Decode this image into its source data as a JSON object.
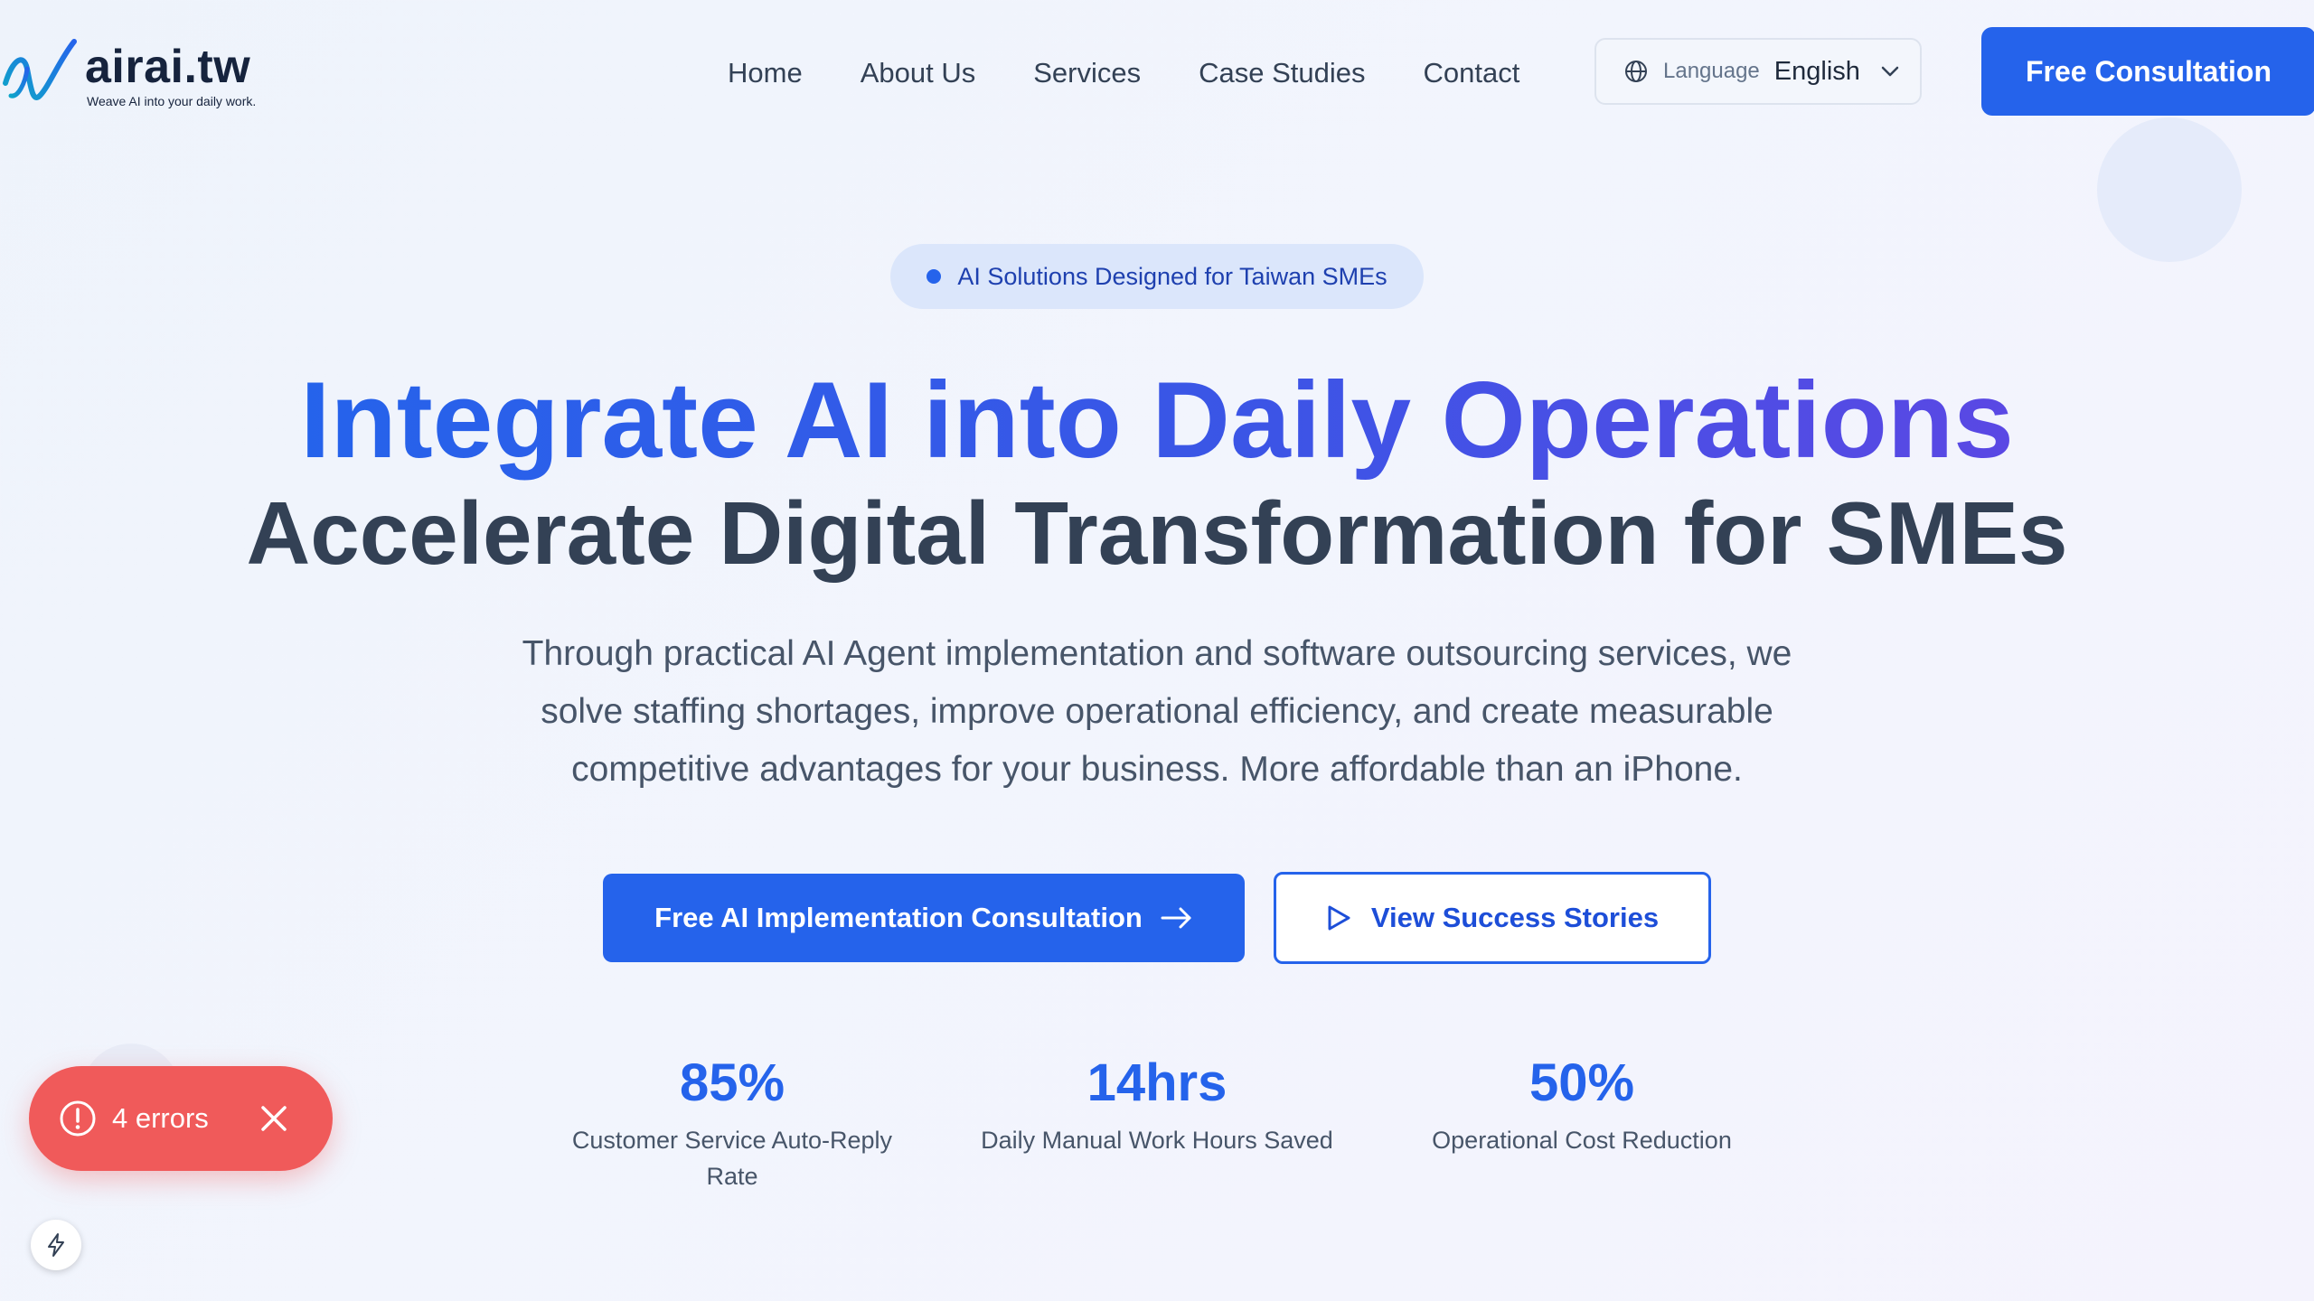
{
  "brand": {
    "name": "airai.tw",
    "tagline": "Weave AI into your daily work.",
    "accent_color": "#2563eb",
    "logo_icon": "stylized-n-logo-icon"
  },
  "nav": {
    "items": [
      {
        "label": "Home"
      },
      {
        "label": "About Us"
      },
      {
        "label": "Services"
      },
      {
        "label": "Case Studies"
      },
      {
        "label": "Contact"
      }
    ]
  },
  "language": {
    "icon": "globe-icon",
    "label": "Language",
    "selected": "English"
  },
  "header_cta": {
    "label": "Free Consultation"
  },
  "hero": {
    "badge": "AI Solutions Designed for Taiwan SMEs",
    "headline_1": "Integrate AI into Daily Operations",
    "headline_2": "Accelerate Digital Transformation for SMEs",
    "description": "Through practical AI Agent implementation and software outsourcing services, we solve staffing shortages, improve operational efficiency, and create measurable competitive advantages for your business. More affordable than an iPhone.",
    "primary_button": "Free AI Implementation Consultation",
    "secondary_button": "View Success Stories"
  },
  "stats": [
    {
      "value": "85%",
      "label": "Customer Service Auto-Reply Rate"
    },
    {
      "value": "14hrs",
      "label": "Daily Manual Work Hours Saved"
    },
    {
      "value": "50%",
      "label": "Operational Cost Reduction"
    }
  ],
  "error_toast": {
    "text": "4 errors",
    "color": "#f05a5a"
  }
}
